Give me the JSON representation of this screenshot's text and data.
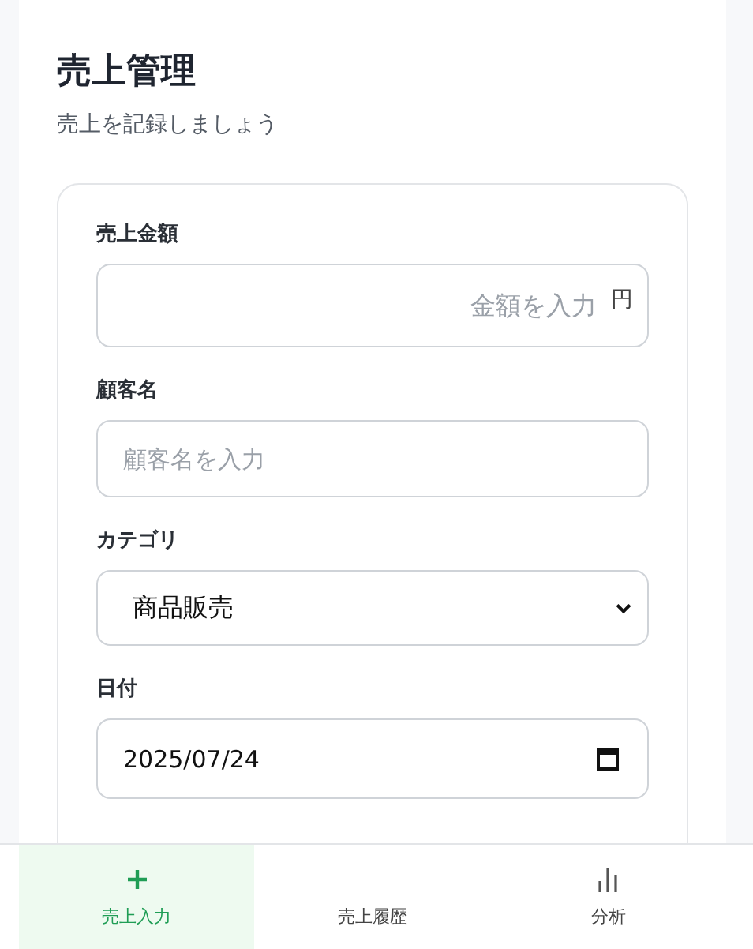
{
  "header": {
    "title": "売上管理",
    "subtitle": "売上を記録しましょう"
  },
  "form": {
    "fields": [
      {
        "kind": "amount",
        "label": "売上金額",
        "placeholder": "金額を入力",
        "suffix": "円"
      },
      {
        "kind": "text",
        "label": "顧客名",
        "placeholder": "顧客名を入力"
      },
      {
        "kind": "select",
        "label": "カテゴリ",
        "value": "商品販売"
      },
      {
        "kind": "date",
        "label": "日付",
        "value": "2025/07/24"
      }
    ]
  },
  "bottom_nav": [
    {
      "label": "売上入力",
      "kind": "plus",
      "selected": true
    },
    {
      "label": "売上履歴",
      "kind": "plain",
      "selected": false
    },
    {
      "label": "分析",
      "kind": "chart",
      "selected": false
    }
  ]
}
